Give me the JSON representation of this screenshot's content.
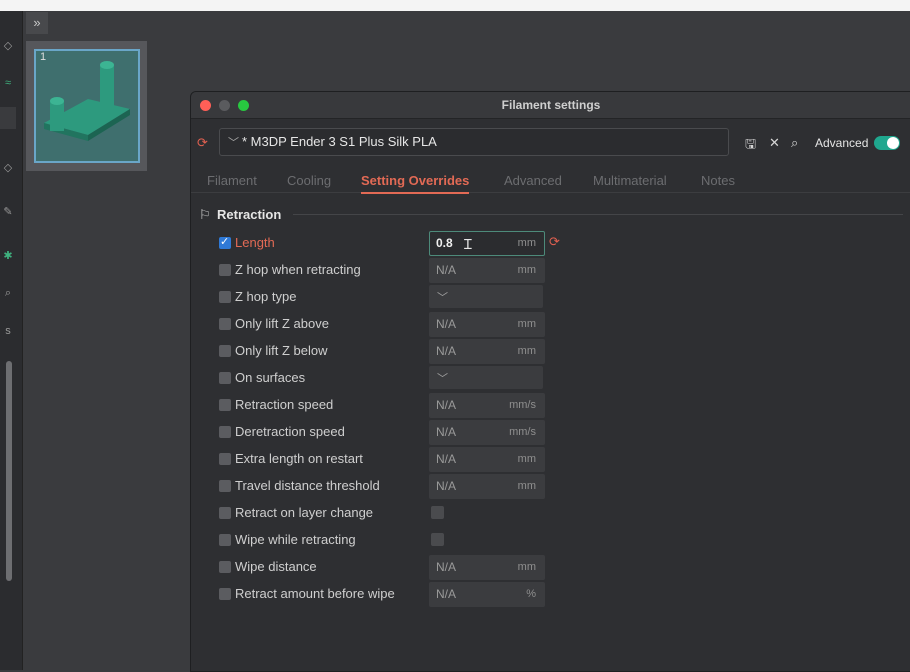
{
  "sidebar": {
    "collapse_icon": "double-chevron-icon"
  },
  "plate": {
    "number": "1"
  },
  "dialog": {
    "title": "Filament settings",
    "preset": {
      "name": "* M3DP Ender 3 S1 Plus Silk PLA"
    },
    "advanced_label": "Advanced",
    "advanced_on": true,
    "tabs": [
      {
        "label": "Filament"
      },
      {
        "label": "Cooling"
      },
      {
        "label": "Setting Overrides"
      },
      {
        "label": "Advanced"
      },
      {
        "label": "Multimaterial"
      },
      {
        "label": "Notes"
      }
    ],
    "active_tab": "Setting Overrides",
    "section": {
      "title": "Retraction"
    },
    "rows": [
      {
        "label": "Length",
        "value": "0.8",
        "unit": "mm",
        "checked": true,
        "type": "field"
      },
      {
        "label": "Z hop when retracting",
        "value": "N/A",
        "unit": "mm",
        "checked": false,
        "type": "field"
      },
      {
        "label": "Z hop type",
        "checked": false,
        "type": "dropdown"
      },
      {
        "label": "Only lift Z above",
        "value": "N/A",
        "unit": "mm",
        "checked": false,
        "type": "field"
      },
      {
        "label": "Only lift Z below",
        "value": "N/A",
        "unit": "mm",
        "checked": false,
        "type": "field"
      },
      {
        "label": "On surfaces",
        "checked": false,
        "type": "dropdown"
      },
      {
        "label": "Retraction speed",
        "value": "N/A",
        "unit": "mm/s",
        "checked": false,
        "type": "field"
      },
      {
        "label": "Deretraction speed",
        "value": "N/A",
        "unit": "mm/s",
        "checked": false,
        "type": "field"
      },
      {
        "label": "Extra length on restart",
        "value": "N/A",
        "unit": "mm",
        "checked": false,
        "type": "field"
      },
      {
        "label": "Travel distance threshold",
        "value": "N/A",
        "unit": "mm",
        "checked": false,
        "type": "field"
      },
      {
        "label": "Retract on layer change",
        "checked": false,
        "type": "checkbox"
      },
      {
        "label": "Wipe while retracting",
        "checked": false,
        "type": "checkbox"
      },
      {
        "label": "Wipe distance",
        "value": "N/A",
        "unit": "mm",
        "checked": false,
        "type": "field"
      },
      {
        "label": "Retract amount before wipe",
        "value": "N/A",
        "unit": "%",
        "checked": false,
        "type": "field"
      }
    ]
  },
  "colors": {
    "accent": "#e26a55",
    "toggle": "#1fa78e",
    "checkbox_on": "#2f79d6",
    "close": "#ff5f57",
    "minimize": "#5a5b5e",
    "maximize": "#28c840"
  }
}
